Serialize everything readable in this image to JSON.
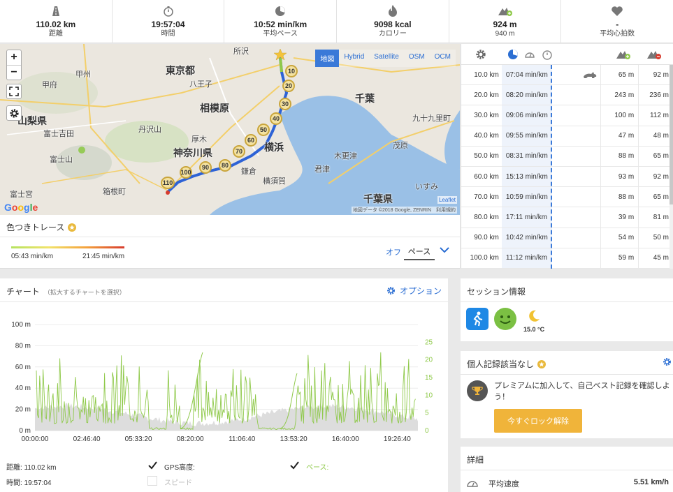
{
  "stats": [
    {
      "icon": "road-icon",
      "value": "110.02 km",
      "label": "距離"
    },
    {
      "icon": "stopwatch-icon",
      "value": "19:57:04",
      "label": "時間"
    },
    {
      "icon": "pace-icon",
      "value": "10:52 min/km",
      "label": "平均ペース"
    },
    {
      "icon": "flame-icon",
      "value": "9098 kcal",
      "label": "カロリー"
    },
    {
      "icon": "elevation-up-icon",
      "value": "924 m",
      "label": "940 m"
    },
    {
      "icon": "heart-icon",
      "value": "-",
      "label": "平均心拍数"
    }
  ],
  "map": {
    "layers": [
      "地図",
      "Hybrid",
      "Satellite",
      "OSM",
      "OCM"
    ],
    "active_layer": "地図",
    "labels": [
      {
        "text": "東京都",
        "big": true
      },
      {
        "text": "相模原",
        "big": true
      },
      {
        "text": "神奈川県",
        "big": true
      },
      {
        "text": "山梨県",
        "big": true
      },
      {
        "text": "千葉",
        "big": true
      },
      {
        "text": "千葉県",
        "big": true
      },
      {
        "text": "八王子",
        "big": false
      },
      {
        "text": "甲府",
        "big": false
      },
      {
        "text": "甲州",
        "big": false
      },
      {
        "text": "所沢",
        "big": false
      },
      {
        "text": "富士山",
        "big": false
      },
      {
        "text": "横須賀",
        "big": false
      },
      {
        "text": "鎌倉",
        "big": false
      },
      {
        "text": "君津",
        "big": false
      },
      {
        "text": "木更津",
        "big": false
      },
      {
        "text": "茂原",
        "big": false
      },
      {
        "text": "丹沢山",
        "big": false
      },
      {
        "text": "富士吉田",
        "big": false
      },
      {
        "text": "箱根町",
        "big": false
      },
      {
        "text": "厚木",
        "big": false
      },
      {
        "text": "富士宮",
        "big": false
      },
      {
        "text": "いすみ",
        "big": false
      },
      {
        "text": "九十九里町",
        "big": false
      },
      {
        "text": "横浜",
        "big": false
      }
    ],
    "markers": [
      "10",
      "20",
      "30",
      "40",
      "50",
      "60",
      "70",
      "80",
      "90",
      "100",
      "110"
    ],
    "google": "Google",
    "leaflet": "Leaflet",
    "attribution": "地図データ ©2018 Google, ZENRIN　利用規約"
  },
  "trace": {
    "title": "色つきトレース",
    "min_label": "05:43 min/km",
    "max_label": "21:45 min/km",
    "off_label": "オフ",
    "pace_label": "ペース"
  },
  "splits": [
    {
      "km": "10.0 km",
      "pace": "07:04 min/km",
      "up": "65 m",
      "down": "92 m",
      "fastest": true
    },
    {
      "km": "20.0 km",
      "pace": "08:20 min/km",
      "up": "243 m",
      "down": "236 m"
    },
    {
      "km": "30.0 km",
      "pace": "09:06 min/km",
      "up": "100 m",
      "down": "112 m"
    },
    {
      "km": "40.0 km",
      "pace": "09:55 min/km",
      "up": "47 m",
      "down": "48 m"
    },
    {
      "km": "50.0 km",
      "pace": "08:31 min/km",
      "up": "88 m",
      "down": "65 m"
    },
    {
      "km": "60.0 km",
      "pace": "15:13 min/km",
      "up": "93 m",
      "down": "92 m"
    },
    {
      "km": "70.0 km",
      "pace": "10:59 min/km",
      "up": "88 m",
      "down": "65 m"
    },
    {
      "km": "80.0 km",
      "pace": "17:11 min/km",
      "up": "39 m",
      "down": "81 m"
    },
    {
      "km": "90.0 km",
      "pace": "10:42 min/km",
      "up": "54 m",
      "down": "50 m"
    },
    {
      "km": "100.0 km",
      "pace": "11:12 min/km",
      "up": "59 m",
      "down": "45 m"
    }
  ],
  "chart": {
    "title": "チャート",
    "subtitle": "（拡大するチャートを選択）",
    "options_label": "オプション",
    "distance": "距離: 110.02 km",
    "time": "時間: 19:57:04",
    "legend": {
      "gps": "GPS高度:",
      "pace": "ペース:",
      "speed": "スピード"
    }
  },
  "chart_data": {
    "type": "line",
    "x_ticks": [
      "00:00:00",
      "02:46:40",
      "05:33:20",
      "08:20:00",
      "11:06:40",
      "13:53:20",
      "16:40:00",
      "19:26:40"
    ],
    "y_left_ticks": [
      "100 m",
      "80 m",
      "60 m",
      "40 m",
      "20 m",
      "0 m"
    ],
    "y_left_range": [
      0,
      100
    ],
    "y_right_ticks": [
      "25",
      "20",
      "15",
      "10",
      "5",
      "0"
    ],
    "y_right_range": [
      0,
      30
    ],
    "series": [
      {
        "name": "GPS高度",
        "color": "#cccccc"
      },
      {
        "name": "ペース",
        "color": "#8fc94a"
      }
    ],
    "grid": true
  },
  "session": {
    "title": "セッション情報",
    "temperature": "15.0 °C"
  },
  "records": {
    "title": "個人記録該当なし",
    "message": "プレミアムに加入して、自己ベスト記録を確認しよう！",
    "button": "今すぐロック解除"
  },
  "details": {
    "title": "詳細",
    "avg_speed_label": "平均速度",
    "avg_speed_value": "5.51 km/h"
  },
  "colors": {
    "accent": "#2b6ed3",
    "pace_green": "#8fc94a",
    "unlock": "#f0b43a"
  }
}
